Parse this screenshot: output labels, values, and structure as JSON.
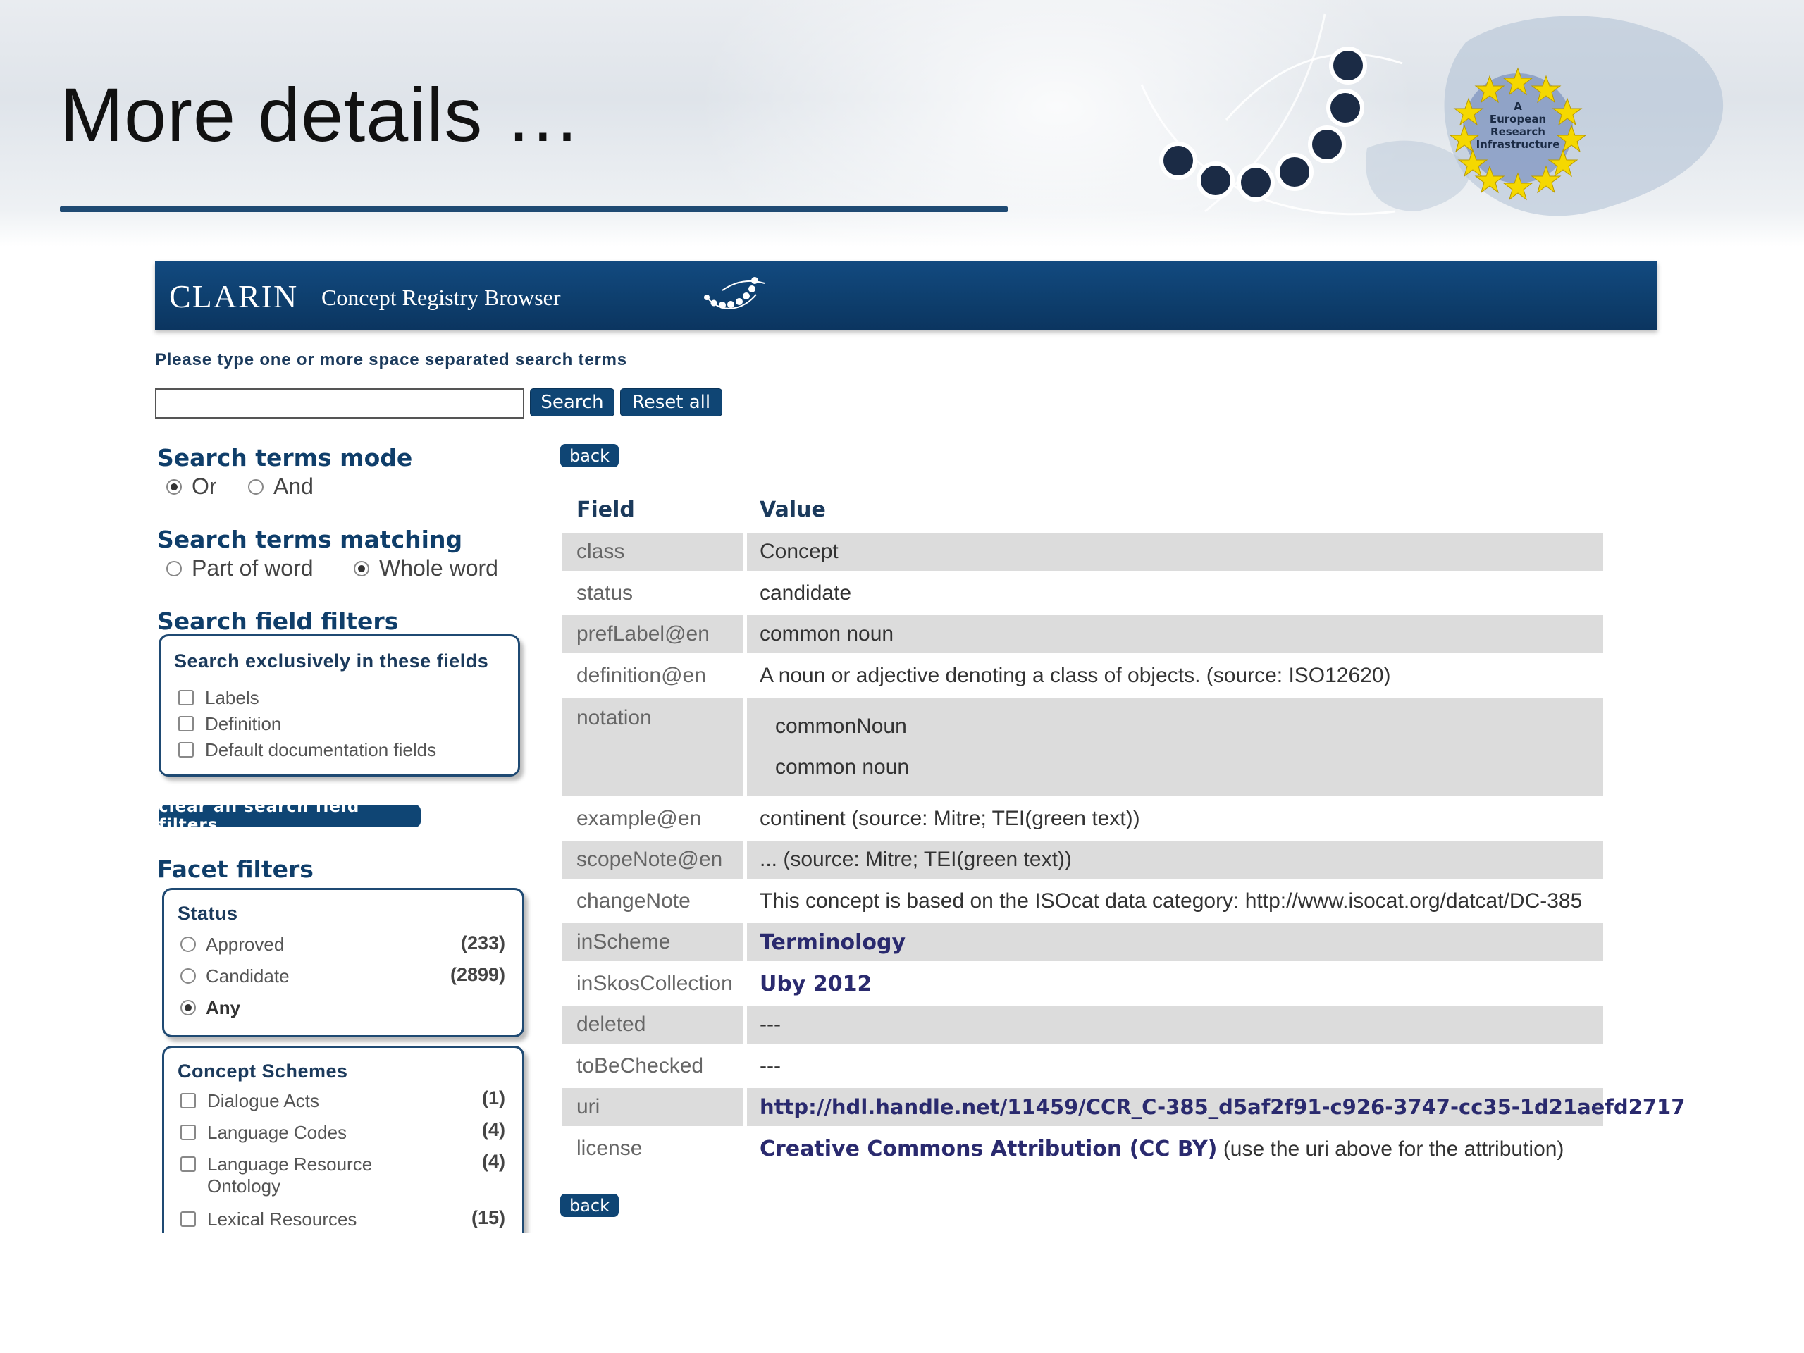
{
  "slide": {
    "title": "More details …",
    "logo_text": [
      "A",
      "European",
      "Research",
      "Infrastructure"
    ]
  },
  "app": {
    "logo": "CLARIN",
    "title": "Concept Registry Browser"
  },
  "search": {
    "hint": "Please type one or more space separated search terms",
    "input_value": "",
    "search_label": "Search",
    "reset_label": "Reset all"
  },
  "sidebar": {
    "mode": {
      "title": "Search terms mode",
      "options": [
        {
          "label": "Or",
          "checked": true
        },
        {
          "label": "And",
          "checked": false
        }
      ]
    },
    "matching": {
      "title": "Search terms matching",
      "options": [
        {
          "label": "Part of word",
          "checked": false
        },
        {
          "label": "Whole word",
          "checked": true
        }
      ]
    },
    "field_filters": {
      "title": "Search field filters",
      "box_title": "Search exclusively in these fields",
      "items": [
        "Labels",
        "Definition",
        "Default documentation fields"
      ],
      "clear_label": "clear all search field filters"
    },
    "facets": {
      "title": "Facet filters",
      "status": {
        "title": "Status",
        "items": [
          {
            "label": "Approved",
            "count": "(233)",
            "checked": false
          },
          {
            "label": "Candidate",
            "count": "(2899)",
            "checked": false
          },
          {
            "label": "Any",
            "count": "",
            "checked": true
          }
        ]
      },
      "schemes": {
        "title": "Concept Schemes",
        "items": [
          {
            "label": "Dialogue Acts",
            "count": "(1)"
          },
          {
            "label": "Language Codes",
            "count": "(4)"
          },
          {
            "label": "Language Resource",
            "label2": "Ontology",
            "count": "(4)"
          },
          {
            "label": "Lexical Resources",
            "count": "(15)"
          }
        ]
      }
    }
  },
  "details": {
    "back_label": "back",
    "header_field": "Field",
    "header_value": "Value",
    "rows": [
      {
        "field": "class",
        "value": "Concept"
      },
      {
        "field": "status",
        "value": "candidate"
      },
      {
        "field": "prefLabel@en",
        "value": "common noun"
      },
      {
        "field": "definition@en",
        "value": "A noun or adjective denoting a class of objects. (source: ISO12620)"
      },
      {
        "field": "notation",
        "value": "commonNoun",
        "value2": "common noun"
      },
      {
        "field": "example@en",
        "value": "continent (source: Mitre; TEI(green text))"
      },
      {
        "field": "scopeNote@en",
        "value": "... (source: Mitre; TEI(green text))"
      },
      {
        "field": "changeNote",
        "value": "This concept is based on the ISOcat data category: http://www.isocat.org/datcat/DC-385"
      },
      {
        "field": "inScheme",
        "value": "Terminology"
      },
      {
        "field": "inSkosCollection",
        "value": "Uby 2012"
      },
      {
        "field": "deleted",
        "value": "---"
      },
      {
        "field": "toBeChecked",
        "value": "---"
      },
      {
        "field": "uri",
        "value": "http://hdl.handle.net/11459/CCR_C-385_d5af2f91-c926-3747-cc35-1d21aefd2717"
      },
      {
        "field": "license",
        "value": "Creative Commons Attribution (CC BY)",
        "value_suffix": " (use the uri above for the attribution)"
      }
    ]
  },
  "colors": {
    "banner": "#0e3f6e",
    "accent": "#0f4574",
    "row_shade": "#dcdcdc",
    "link": "#2a2a6e",
    "star": "#f5d800"
  }
}
